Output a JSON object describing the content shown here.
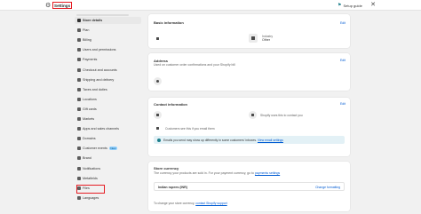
{
  "topbar": {
    "title": "Settings",
    "setup_guide": "Setup guide"
  },
  "sidebar": {
    "items": [
      {
        "label": "Store details",
        "icon": "store-icon",
        "active": true
      },
      {
        "label": "Plan",
        "icon": "plan-icon"
      },
      {
        "label": "Billing",
        "icon": "billing-icon"
      },
      {
        "label": "Users and permissions",
        "icon": "users-icon"
      },
      {
        "label": "Payments",
        "icon": "payments-icon"
      },
      {
        "label": "Checkout and accounts",
        "icon": "checkout-icon"
      },
      {
        "label": "Shipping and delivery",
        "icon": "shipping-icon"
      },
      {
        "label": "Taxes and duties",
        "icon": "taxes-icon"
      },
      {
        "label": "Locations",
        "icon": "location-icon"
      },
      {
        "label": "Gift cards",
        "icon": "gift-card-icon"
      },
      {
        "label": "Markets",
        "icon": "globe-icon"
      },
      {
        "label": "Apps and sales channels",
        "icon": "apps-icon"
      },
      {
        "label": "Domains",
        "icon": "globe-icon"
      },
      {
        "label": "Customer events",
        "icon": "events-icon",
        "badge": "New"
      },
      {
        "label": "Brand",
        "icon": "brand-icon"
      },
      {
        "label": "Notifications",
        "icon": "bell-icon"
      },
      {
        "label": "Metafields",
        "icon": "metafields-icon",
        "highlighted": true
      },
      {
        "label": "Files",
        "icon": "file-icon"
      },
      {
        "label": "Languages",
        "icon": "language-icon"
      }
    ]
  },
  "basic_info": {
    "title": "Basic information",
    "edit": "Edit",
    "industry_label": "Industry",
    "industry_value": "Other"
  },
  "address": {
    "title": "Address",
    "subtitle": "Used on customer order confirmations and your Shopify bill",
    "edit": "Edit"
  },
  "contact": {
    "title": "Contact information",
    "edit": "Edit",
    "shopify_note": "Shopify uses this to contact you",
    "customer_note": "Customers see this if you email them",
    "banner_text": "Emails you send may show up differently in some customers' inboxes.",
    "banner_link": "View email settings"
  },
  "currency": {
    "title": "Store currency",
    "subtitle": "The currency your products are sold in. For your payment currency, go to",
    "subtitle_link": "payments settings",
    "value": "Indian rupees (INR)",
    "change_link": "Change formatting",
    "footer": "To change your store currency,",
    "footer_link": "contact Shopify support"
  },
  "colors": {
    "accent_link": "#005bd3",
    "highlight_red": "#e51c23"
  }
}
